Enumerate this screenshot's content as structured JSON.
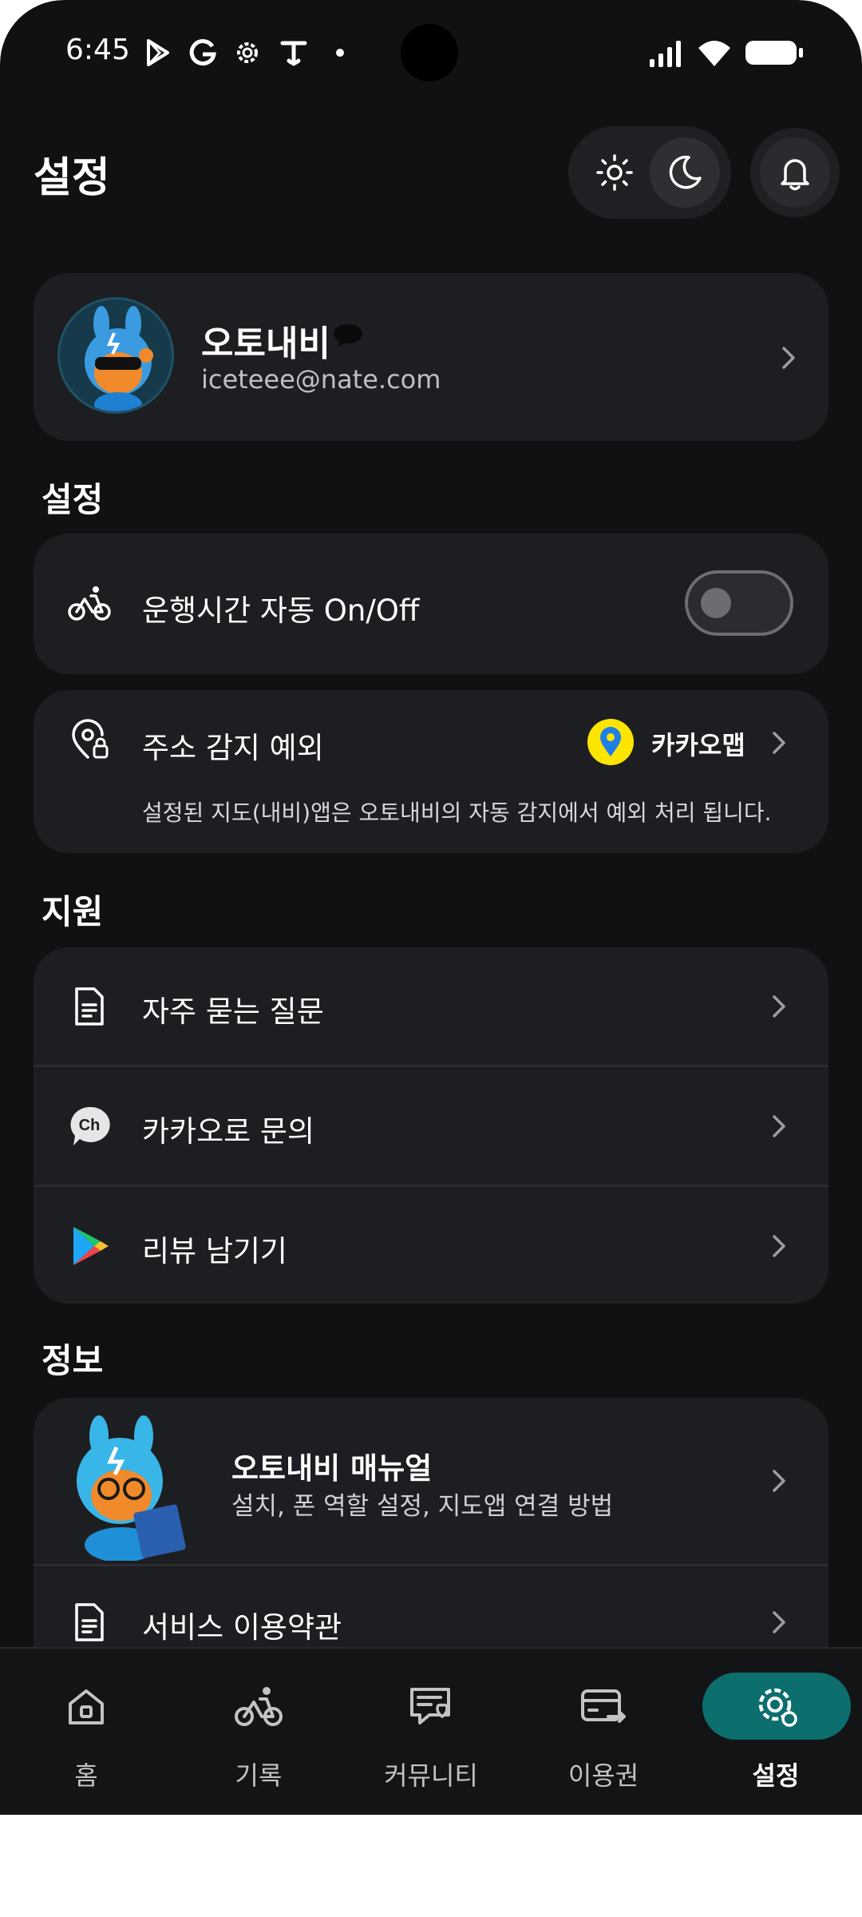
{
  "status_bar": {
    "time": "6:45",
    "icons": [
      "play-store-icon",
      "google-icon",
      "settings-gear-icon",
      "t-app-icon",
      "dot-icon",
      "signal-icon",
      "wifi-icon",
      "battery-icon"
    ]
  },
  "header": {
    "title": "설정",
    "theme": {
      "options": [
        "light",
        "dark"
      ],
      "selected": "dark"
    }
  },
  "profile": {
    "name": "오토내비",
    "email": "iceteee@nate.com"
  },
  "sections": {
    "settings": {
      "title": "설정",
      "auto_toggle": {
        "label": "운행시간 자동 On/Off",
        "on": false
      },
      "address_exclusion": {
        "label": "주소 감지 예외",
        "map_app": "카카오맵",
        "description": "설정된 지도(내비)앱은 오토내비의 자동 감지에서 예외 처리 됩니다."
      }
    },
    "support": {
      "title": "지원",
      "items": [
        {
          "label": "자주 묻는 질문",
          "icon": "document-icon"
        },
        {
          "label": "카카오로 문의",
          "icon": "kakao-channel-icon"
        },
        {
          "label": "리뷰 남기기",
          "icon": "google-play-icon"
        }
      ]
    },
    "info": {
      "title": "정보",
      "manual": {
        "title": "오토내비 매뉴얼",
        "subtitle": "설치, 폰 역할 설정, 지도앱 연결 방법"
      },
      "terms": {
        "label": "서비스 이용약관"
      }
    }
  },
  "bottom_nav": {
    "items": [
      {
        "label": "홈",
        "icon": "home-icon"
      },
      {
        "label": "기록",
        "icon": "bike-icon"
      },
      {
        "label": "커뮤니티",
        "icon": "community-icon"
      },
      {
        "label": "이용권",
        "icon": "ticket-icon"
      },
      {
        "label": "설정",
        "icon": "settings-icon"
      }
    ],
    "active": "설정"
  },
  "colors": {
    "background": "#111113",
    "card": "#1d1e21",
    "accent": "#0d6e6e",
    "map_pin": "#fde500"
  }
}
